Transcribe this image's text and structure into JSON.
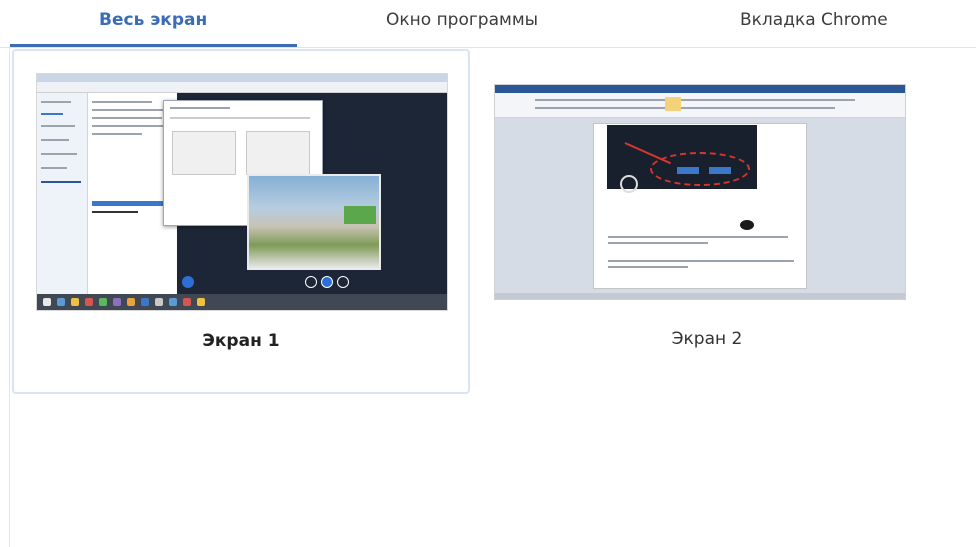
{
  "tabs": [
    {
      "label": "Весь экран",
      "active": true
    },
    {
      "label": "Окно программы",
      "active": false
    },
    {
      "label": "Вкладка Chrome",
      "active": false
    }
  ],
  "screens": [
    {
      "label": "Экран 1",
      "selected": true
    },
    {
      "label": "Экран 2",
      "selected": false
    }
  ],
  "colors": {
    "accent": "#3a6db3",
    "selected_border": "#d7e4f3"
  }
}
